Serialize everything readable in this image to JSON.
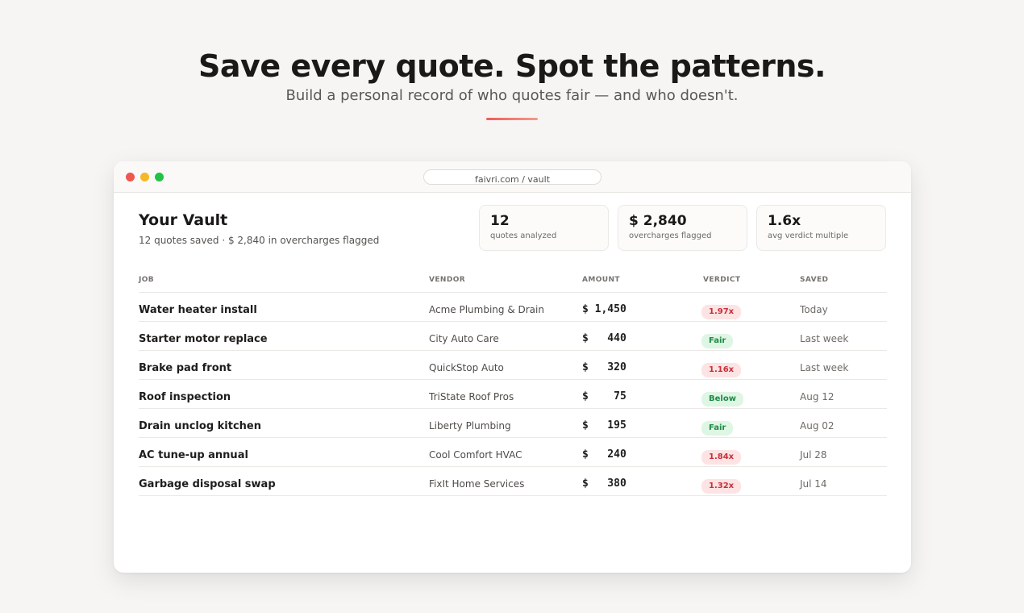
{
  "hero": {
    "title": "Save every quote. Spot the patterns.",
    "subtitle": "Build a personal record of who quotes fair — and who doesn't."
  },
  "browser": {
    "url": "faivri.com / vault"
  },
  "vault": {
    "title": "Your Vault",
    "summary": "12 quotes saved · $ 2,840 in overcharges flagged"
  },
  "stats": [
    {
      "value": "12",
      "label": "quotes analyzed"
    },
    {
      "value": "$ 2,840",
      "label": "overcharges flagged"
    },
    {
      "value": "1.6x",
      "label": "avg verdict multiple"
    }
  ],
  "table": {
    "headers": {
      "job": "JOB",
      "vendor": "VENDOR",
      "amount": "AMOUNT",
      "verdict": "VERDICT",
      "saved": "SAVED"
    },
    "rows": [
      {
        "job": "Water heater install",
        "vendor": "Acme Plumbing & Drain",
        "amount": "$ 1,450",
        "verdict": "1.97x",
        "verdict_type": "bad",
        "saved": "Today"
      },
      {
        "job": "Starter motor replace",
        "vendor": "City Auto Care",
        "amount": "$   440",
        "verdict": "Fair",
        "verdict_type": "good",
        "saved": "Last week"
      },
      {
        "job": "Brake pad front",
        "vendor": "QuickStop Auto",
        "amount": "$   320",
        "verdict": "1.16x",
        "verdict_type": "bad",
        "saved": "Last week"
      },
      {
        "job": "Roof inspection",
        "vendor": "TriState Roof Pros",
        "amount": "$    75",
        "verdict": "Below",
        "verdict_type": "good",
        "saved": "Aug 12"
      },
      {
        "job": "Drain unclog kitchen",
        "vendor": "Liberty Plumbing",
        "amount": "$   195",
        "verdict": "Fair",
        "verdict_type": "good",
        "saved": "Aug 02"
      },
      {
        "job": "AC tune-up annual",
        "vendor": "Cool Comfort HVAC",
        "amount": "$   240",
        "verdict": "1.84x",
        "verdict_type": "bad",
        "saved": "Jul 28"
      },
      {
        "job": "Garbage disposal swap",
        "vendor": "FixIt Home Services",
        "amount": "$   380",
        "verdict": "1.32x",
        "verdict_type": "bad",
        "saved": "Jul 14"
      }
    ]
  }
}
